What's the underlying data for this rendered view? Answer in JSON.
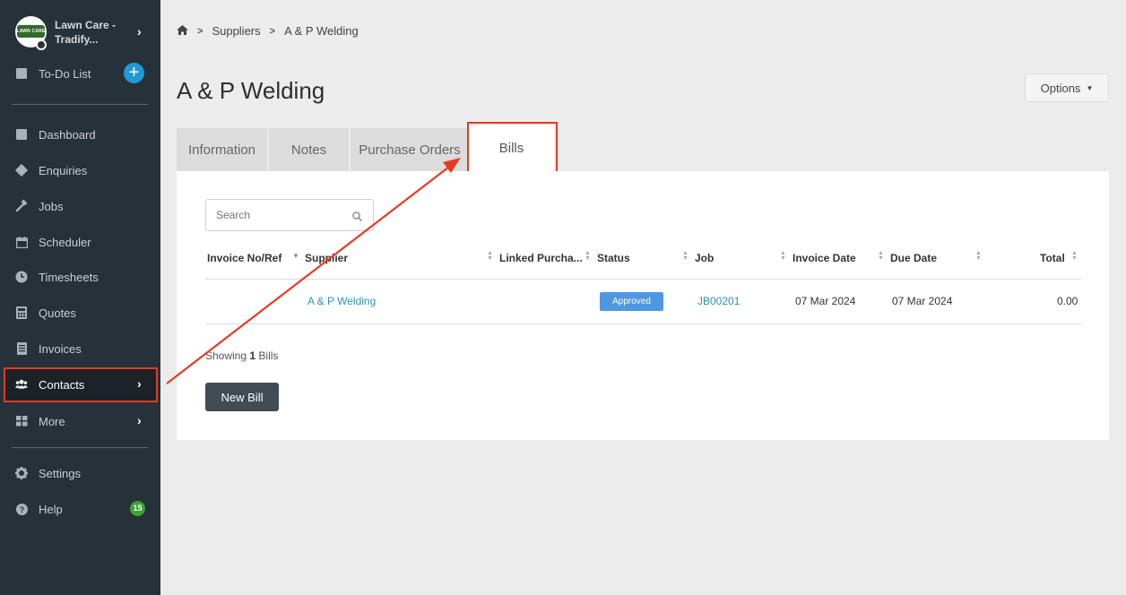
{
  "sidebar": {
    "org_name": "Lawn Care - Tradify...",
    "logo_text": "LAWN CARE",
    "todo": "To-Do List",
    "items": [
      {
        "label": "Dashboard"
      },
      {
        "label": "Enquiries"
      },
      {
        "label": "Jobs"
      },
      {
        "label": "Scheduler"
      },
      {
        "label": "Timesheets"
      },
      {
        "label": "Quotes"
      },
      {
        "label": "Invoices"
      },
      {
        "label": "Contacts"
      },
      {
        "label": "More"
      }
    ],
    "settings": "Settings",
    "help": "Help",
    "help_badge": "15"
  },
  "breadcrumb": {
    "items": [
      "Suppliers",
      "A & P Welding"
    ]
  },
  "page": {
    "title": "A & P Welding",
    "options_label": "Options"
  },
  "tabs": [
    "Information",
    "Notes",
    "Purchase Orders",
    "Bills"
  ],
  "table": {
    "search_placeholder": "Search",
    "columns": [
      "Invoice No/Ref",
      "Supplier",
      "Linked Purcha...",
      "Status",
      "Job",
      "Invoice Date",
      "Due Date",
      "Total"
    ],
    "rows": [
      {
        "invoice": "",
        "supplier": "A & P Welding",
        "linked": "",
        "status": "Approved",
        "job": "JB00201",
        "invoice_date": "07 Mar 2024",
        "due_date": "07 Mar 2024",
        "total": "0.00"
      }
    ],
    "showing_prefix": "Showing",
    "showing_count": "1",
    "showing_suffix": "Bills",
    "new_button": "New Bill"
  },
  "colors": {
    "accent": "#1f9ad6",
    "annotation": "#e63a22",
    "status_approved": "#4e98e0",
    "link": "#2a8fbd"
  }
}
